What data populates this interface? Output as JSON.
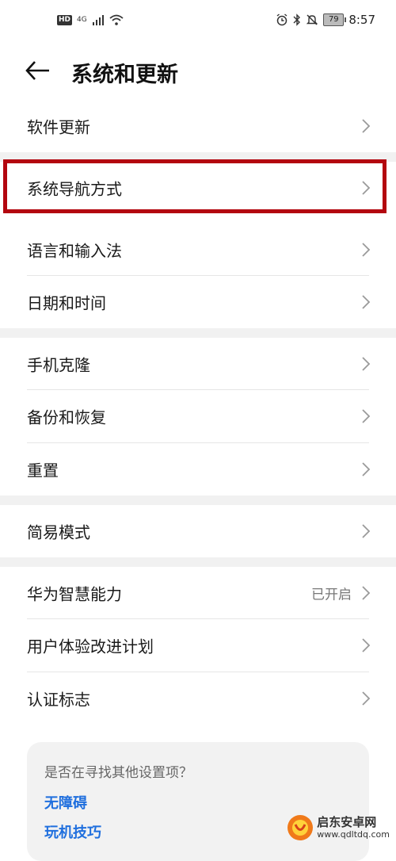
{
  "status_bar": {
    "hd_label": "HD",
    "network_label": "4G",
    "battery_level": "79",
    "time": "8:57"
  },
  "header": {
    "title": "系统和更新"
  },
  "sections": [
    {
      "items": [
        {
          "label": "软件更新"
        }
      ]
    },
    {
      "items": [
        {
          "label": "系统导航方式"
        }
      ]
    },
    {
      "items": [
        {
          "label": "语言和输入法"
        },
        {
          "label": "日期和时间"
        }
      ]
    },
    {
      "items": [
        {
          "label": "手机克隆"
        },
        {
          "label": "备份和恢复"
        },
        {
          "label": "重置"
        }
      ]
    },
    {
      "items": [
        {
          "label": "简易模式"
        }
      ]
    },
    {
      "items": [
        {
          "label": "华为智慧能力",
          "value": "已开启"
        },
        {
          "label": "用户体验改进计划"
        },
        {
          "label": "认证标志"
        }
      ]
    }
  ],
  "suggestion_card": {
    "title": "是否在寻找其他设置项？",
    "links": [
      "无障碍",
      "玩机技巧"
    ]
  },
  "watermark": {
    "name": "启东安卓网",
    "url": "www.qdltdq.com"
  },
  "colors": {
    "highlight_border": "#b3060f",
    "link": "#1f6fde",
    "section_gap": "#f1f1f1"
  }
}
